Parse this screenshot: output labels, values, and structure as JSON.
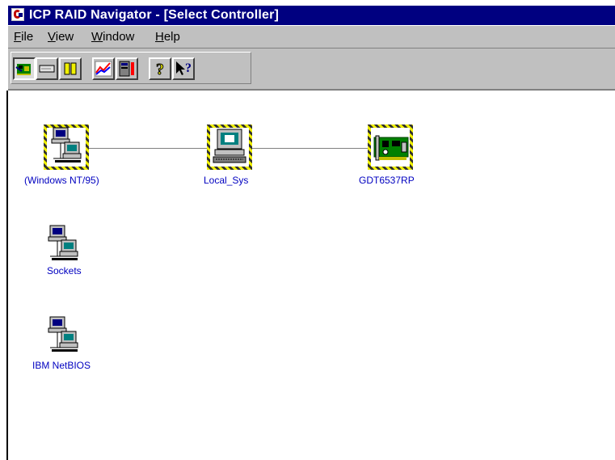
{
  "window": {
    "title": "ICP RAID Navigator - [Select Controller]"
  },
  "menu": {
    "items": [
      {
        "id": "file",
        "label_mnemonic": "F",
        "label_rest": "ile"
      },
      {
        "id": "view",
        "label_mnemonic": "V",
        "label_rest": "iew"
      },
      {
        "id": "window",
        "label_mnemonic": "W",
        "label_rest": "indow"
      },
      {
        "id": "help",
        "label_mnemonic": "H",
        "label_rest": "elp"
      }
    ]
  },
  "toolbar": {
    "buttons": [
      {
        "icon": "select-controller-icon",
        "pressed": true
      },
      {
        "icon": "logical-drive-icon",
        "pressed": false
      },
      {
        "icon": "host-drives-icon",
        "pressed": false
      },
      {
        "icon": "statistics-chart-icon",
        "pressed": false
      },
      {
        "icon": "monitor-icon",
        "pressed": false
      },
      {
        "icon": "help-question-icon",
        "pressed": false
      },
      {
        "icon": "context-help-icon",
        "pressed": false
      }
    ]
  },
  "nodes": {
    "windows_nt": {
      "label": "(Windows NT/95)",
      "icon": "network-computers-icon",
      "selected": true
    },
    "local_sys": {
      "label": "Local_Sys",
      "icon": "computer-icon",
      "selected": true
    },
    "controller": {
      "label": "GDT6537RP",
      "icon": "raid-controller-card-icon",
      "selected": true
    },
    "sockets": {
      "label": "Sockets",
      "icon": "network-computers-icon",
      "selected": false
    },
    "netbios": {
      "label": "IBM NetBIOS",
      "icon": "network-computers-icon",
      "selected": false
    }
  },
  "colors": {
    "titlebar": "#000080",
    "chrome": "#c0c0c0",
    "label_text": "#0000c0",
    "selection_hatch": "#f0f000"
  }
}
